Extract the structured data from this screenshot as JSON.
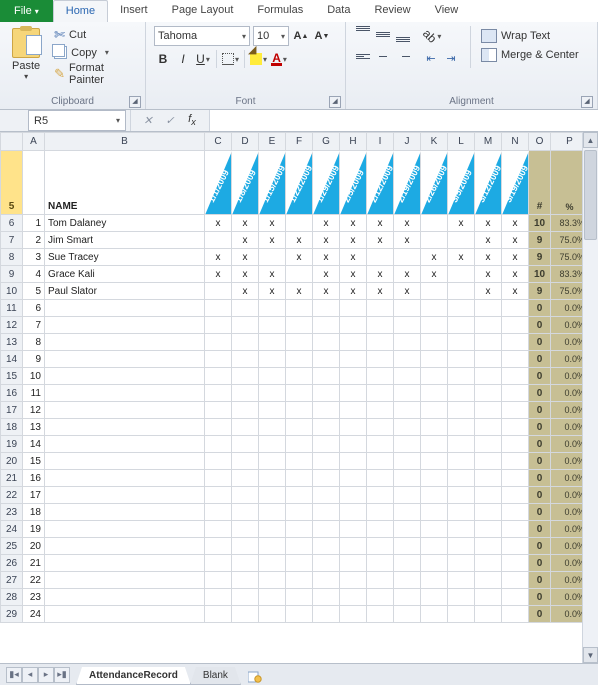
{
  "tabs": {
    "file": "File",
    "home": "Home",
    "insert": "Insert",
    "pagelayout": "Page Layout",
    "formulas": "Formulas",
    "data": "Data",
    "review": "Review",
    "view": "View"
  },
  "active_tab": "Home",
  "clipboard": {
    "paste": "Paste",
    "cut": "Cut",
    "copy": "Copy",
    "format_painter": "Format Painter",
    "group": "Clipboard"
  },
  "font": {
    "name": "Tahoma",
    "size": "10",
    "group": "Font"
  },
  "alignment": {
    "wrap": "Wrap Text",
    "merge": "Merge & Center",
    "group": "Alignment"
  },
  "namebox": "R5",
  "formula": "",
  "columns": [
    "A",
    "B",
    "C",
    "D",
    "E",
    "F",
    "G",
    "H",
    "I",
    "J",
    "K",
    "L",
    "M",
    "N",
    "O",
    "P"
  ],
  "header_row_num": "5",
  "name_header": "NAME",
  "count_header": "#",
  "pct_header": "%",
  "dates": [
    "1/1/2009",
    "1/8/2009",
    "1/15/2009",
    "1/22/2009",
    "1/29/2009",
    "2/5/2009",
    "2/12/2009",
    "2/19/2009",
    "2/26/2009",
    "3/5/2009",
    "3/12/2009",
    "3/19/2009"
  ],
  "rows": [
    {
      "r": "6",
      "n": "1",
      "name": "Tom Dalaney",
      "m": [
        "x",
        "x",
        "x",
        "",
        "x",
        "x",
        "x",
        "x",
        "",
        "x",
        "x",
        "x"
      ],
      "c": "10",
      "p": "83.3%"
    },
    {
      "r": "7",
      "n": "2",
      "name": "Jim Smart",
      "m": [
        "",
        "x",
        "x",
        "x",
        "x",
        "x",
        "x",
        "x",
        "",
        "",
        "x",
        "x"
      ],
      "c": "9",
      "p": "75.0%"
    },
    {
      "r": "8",
      "n": "3",
      "name": "Sue Tracey",
      "m": [
        "x",
        "x",
        "",
        "x",
        "x",
        "x",
        "",
        "",
        "x",
        "x",
        "x",
        "x"
      ],
      "c": "9",
      "p": "75.0%"
    },
    {
      "r": "9",
      "n": "4",
      "name": "Grace Kali",
      "m": [
        "x",
        "x",
        "x",
        "",
        "x",
        "x",
        "x",
        "x",
        "x",
        "",
        "x",
        "x"
      ],
      "c": "10",
      "p": "83.3%"
    },
    {
      "r": "10",
      "n": "5",
      "name": "Paul Slator",
      "m": [
        "",
        "x",
        "x",
        "x",
        "x",
        "x",
        "x",
        "x",
        "",
        "",
        "x",
        "x"
      ],
      "c": "9",
      "p": "75.0%"
    },
    {
      "r": "11",
      "n": "6",
      "name": "",
      "m": [
        "",
        "",
        "",
        "",
        "",
        "",
        "",
        "",
        "",
        "",
        "",
        ""
      ],
      "c": "0",
      "p": "0.0%"
    },
    {
      "r": "12",
      "n": "7",
      "name": "",
      "m": [
        "",
        "",
        "",
        "",
        "",
        "",
        "",
        "",
        "",
        "",
        "",
        ""
      ],
      "c": "0",
      "p": "0.0%"
    },
    {
      "r": "13",
      "n": "8",
      "name": "",
      "m": [
        "",
        "",
        "",
        "",
        "",
        "",
        "",
        "",
        "",
        "",
        "",
        ""
      ],
      "c": "0",
      "p": "0.0%"
    },
    {
      "r": "14",
      "n": "9",
      "name": "",
      "m": [
        "",
        "",
        "",
        "",
        "",
        "",
        "",
        "",
        "",
        "",
        "",
        ""
      ],
      "c": "0",
      "p": "0.0%"
    },
    {
      "r": "15",
      "n": "10",
      "name": "",
      "m": [
        "",
        "",
        "",
        "",
        "",
        "",
        "",
        "",
        "",
        "",
        "",
        ""
      ],
      "c": "0",
      "p": "0.0%"
    },
    {
      "r": "16",
      "n": "11",
      "name": "",
      "m": [
        "",
        "",
        "",
        "",
        "",
        "",
        "",
        "",
        "",
        "",
        "",
        ""
      ],
      "c": "0",
      "p": "0.0%"
    },
    {
      "r": "17",
      "n": "12",
      "name": "",
      "m": [
        "",
        "",
        "",
        "",
        "",
        "",
        "",
        "",
        "",
        "",
        "",
        ""
      ],
      "c": "0",
      "p": "0.0%"
    },
    {
      "r": "18",
      "n": "13",
      "name": "",
      "m": [
        "",
        "",
        "",
        "",
        "",
        "",
        "",
        "",
        "",
        "",
        "",
        ""
      ],
      "c": "0",
      "p": "0.0%"
    },
    {
      "r": "19",
      "n": "14",
      "name": "",
      "m": [
        "",
        "",
        "",
        "",
        "",
        "",
        "",
        "",
        "",
        "",
        "",
        ""
      ],
      "c": "0",
      "p": "0.0%"
    },
    {
      "r": "20",
      "n": "15",
      "name": "",
      "m": [
        "",
        "",
        "",
        "",
        "",
        "",
        "",
        "",
        "",
        "",
        "",
        ""
      ],
      "c": "0",
      "p": "0.0%"
    },
    {
      "r": "21",
      "n": "16",
      "name": "",
      "m": [
        "",
        "",
        "",
        "",
        "",
        "",
        "",
        "",
        "",
        "",
        "",
        ""
      ],
      "c": "0",
      "p": "0.0%"
    },
    {
      "r": "22",
      "n": "17",
      "name": "",
      "m": [
        "",
        "",
        "",
        "",
        "",
        "",
        "",
        "",
        "",
        "",
        "",
        ""
      ],
      "c": "0",
      "p": "0.0%"
    },
    {
      "r": "23",
      "n": "18",
      "name": "",
      "m": [
        "",
        "",
        "",
        "",
        "",
        "",
        "",
        "",
        "",
        "",
        "",
        ""
      ],
      "c": "0",
      "p": "0.0%"
    },
    {
      "r": "24",
      "n": "19",
      "name": "",
      "m": [
        "",
        "",
        "",
        "",
        "",
        "",
        "",
        "",
        "",
        "",
        "",
        ""
      ],
      "c": "0",
      "p": "0.0%"
    },
    {
      "r": "25",
      "n": "20",
      "name": "",
      "m": [
        "",
        "",
        "",
        "",
        "",
        "",
        "",
        "",
        "",
        "",
        "",
        ""
      ],
      "c": "0",
      "p": "0.0%"
    },
    {
      "r": "26",
      "n": "21",
      "name": "",
      "m": [
        "",
        "",
        "",
        "",
        "",
        "",
        "",
        "",
        "",
        "",
        "",
        ""
      ],
      "c": "0",
      "p": "0.0%"
    },
    {
      "r": "27",
      "n": "22",
      "name": "",
      "m": [
        "",
        "",
        "",
        "",
        "",
        "",
        "",
        "",
        "",
        "",
        "",
        ""
      ],
      "c": "0",
      "p": "0.0%"
    },
    {
      "r": "28",
      "n": "23",
      "name": "",
      "m": [
        "",
        "",
        "",
        "",
        "",
        "",
        "",
        "",
        "",
        "",
        "",
        ""
      ],
      "c": "0",
      "p": "0.0%"
    },
    {
      "r": "29",
      "n": "24",
      "name": "",
      "m": [
        "",
        "",
        "",
        "",
        "",
        "",
        "",
        "",
        "",
        "",
        "",
        ""
      ],
      "c": "0",
      "p": "0.0%"
    }
  ],
  "sheets": {
    "active": "AttendanceRecord",
    "other": "Blank"
  }
}
